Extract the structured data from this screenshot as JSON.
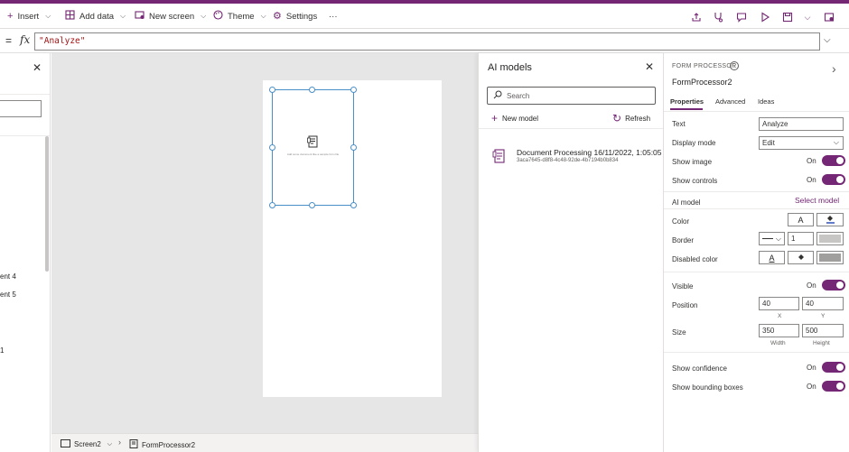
{
  "toolbar": {
    "insert": "Insert",
    "add_data": "Add data",
    "new_screen": "New screen",
    "theme": "Theme",
    "settings": "Settings",
    "more": "···"
  },
  "formula_bar": {
    "equals": "=",
    "fx": "fx",
    "value": "\"Analyze\""
  },
  "left_panel": {
    "items": [
      "ent 4",
      "ent 5",
      "1"
    ]
  },
  "canvas": {
    "control_hint": "Add some document like a sample form file"
  },
  "status_bar": {
    "screen": "Screen2",
    "control": "FormProcessor2"
  },
  "ai_models": {
    "title": "AI models",
    "search_placeholder": "Search",
    "new_model": "New model",
    "refresh": "Refresh",
    "model": {
      "name": "Document Processing 16/11/2022, 1:05:05 ...",
      "id": "3aca7645-d8f8-4c48-92de-4b7194b0b834"
    }
  },
  "properties": {
    "type": "FORM PROCESSOR",
    "name": "FormProcessor2",
    "tabs": [
      "Properties",
      "Advanced",
      "Ideas"
    ],
    "text_label": "Text",
    "text_value": "Analyze",
    "display_mode_label": "Display mode",
    "display_mode_value": "Edit",
    "show_image_label": "Show image",
    "show_controls_label": "Show controls",
    "on": "On",
    "ai_model_label": "AI model",
    "select_model": "Select model",
    "color_label": "Color",
    "border_label": "Border",
    "border_width": "1",
    "disabled_color_label": "Disabled color",
    "visible_label": "Visible",
    "position_label": "Position",
    "pos_x": "40",
    "pos_y": "40",
    "x_label": "X",
    "y_label": "Y",
    "size_label": "Size",
    "width": "350",
    "height": "500",
    "width_label": "Width",
    "height_label": "Height",
    "show_confidence_label": "Show confidence",
    "show_bounding_label": "Show bounding boxes",
    "glyph_a": "A"
  },
  "colors": {
    "brand": "#742774",
    "selection": "#4a90c8"
  }
}
